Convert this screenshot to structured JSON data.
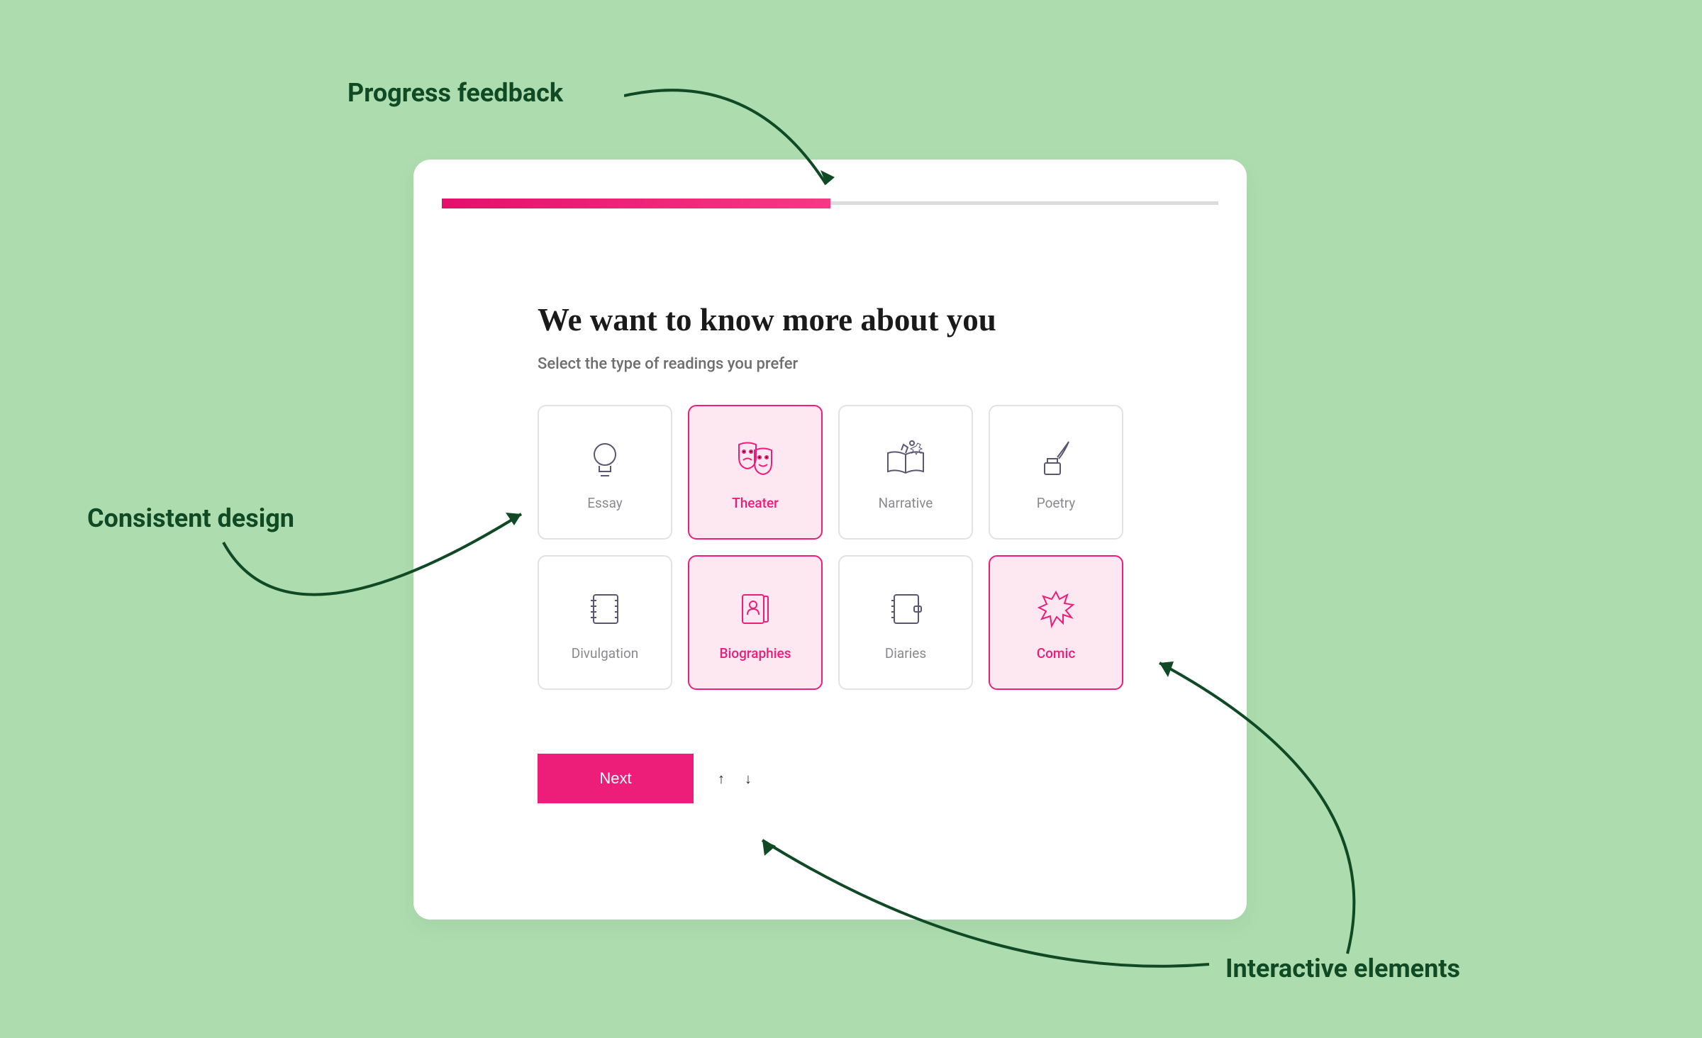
{
  "annotations": {
    "progress": "Progress feedback",
    "consistent": "Consistent design",
    "interactive": "Interactive elements"
  },
  "dialog": {
    "heading": "We want to know more about you",
    "subheading": "Select the type of readings you prefer",
    "progress_percent": 50,
    "tiles": [
      {
        "label": "Essay",
        "selected": false
      },
      {
        "label": "Theater",
        "selected": true
      },
      {
        "label": "Narrative",
        "selected": false
      },
      {
        "label": "Poetry",
        "selected": false
      },
      {
        "label": "Divulgation",
        "selected": false
      },
      {
        "label": "Biographies",
        "selected": true
      },
      {
        "label": "Diaries",
        "selected": false
      },
      {
        "label": "Comic",
        "selected": true
      }
    ],
    "next_label": "Next"
  },
  "colors": {
    "background": "#adddae",
    "annotation_text": "#0f4a24",
    "accent": "#ec1e79",
    "tile_selected_bg": "#fde7f0",
    "tile_border": "#e2e2e2",
    "icon_stroke": "#5c5672"
  }
}
